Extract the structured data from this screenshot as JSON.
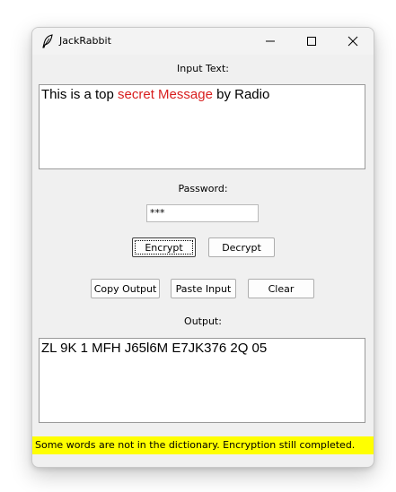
{
  "window": {
    "title": "JackRabbit",
    "app_icon": "feather-icon",
    "controls": {
      "minimize": "minimize-icon",
      "maximize": "maximize-icon",
      "close": "close-icon"
    }
  },
  "input": {
    "label": "Input Text:",
    "text_part1": "This is a top ",
    "text_highlight": "secret Message",
    "text_part2": " by Radio",
    "highlight_color": "#d81e1e"
  },
  "password": {
    "label": "Password:",
    "value": "***"
  },
  "buttons": {
    "encrypt": "Encrypt",
    "decrypt": "Decrypt",
    "copy_output": "Copy Output",
    "paste_input": "Paste Input",
    "clear": "Clear"
  },
  "output": {
    "label": "Output:",
    "text": "ZL 9K 1 MFH J65l6M E7JK376 2Q 05"
  },
  "status": {
    "message": "Some words are not in the dictionary. Encryption still completed.",
    "background": "#ffff00"
  }
}
